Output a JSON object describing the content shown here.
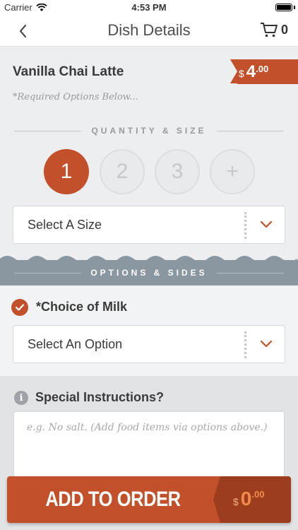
{
  "status_bar": {
    "carrier": "Carrier",
    "time": "4:53 PM"
  },
  "nav": {
    "title": "Dish Details",
    "cart_count": "0"
  },
  "dish": {
    "name": "Vanilla Chai Latte",
    "price_currency": "$",
    "price_whole": "4",
    "price_fraction": ".00",
    "required_note": "*Required Options Below..."
  },
  "quantity": {
    "section_label": "QUANTITY & SIZE",
    "options": [
      "1",
      "2",
      "3",
      "+"
    ],
    "selected": "1",
    "size_placeholder": "Select A Size"
  },
  "options": {
    "section_label": "OPTIONS & SIDES",
    "milk_label": "*Choice of Milk",
    "milk_placeholder": "Select An Option"
  },
  "instructions": {
    "label": "Special Instructions?",
    "placeholder": "e.g. No salt. (Add food items via options above.)",
    "value": ""
  },
  "order": {
    "button_label": "ADD TO ORDER",
    "total_currency": "$",
    "total_whole": "0",
    "total_fraction": ".00"
  },
  "colors": {
    "accent": "#c2502a",
    "accent_dark": "#9c3d1d",
    "band": "#8b97a0",
    "background": "#edeef0"
  }
}
